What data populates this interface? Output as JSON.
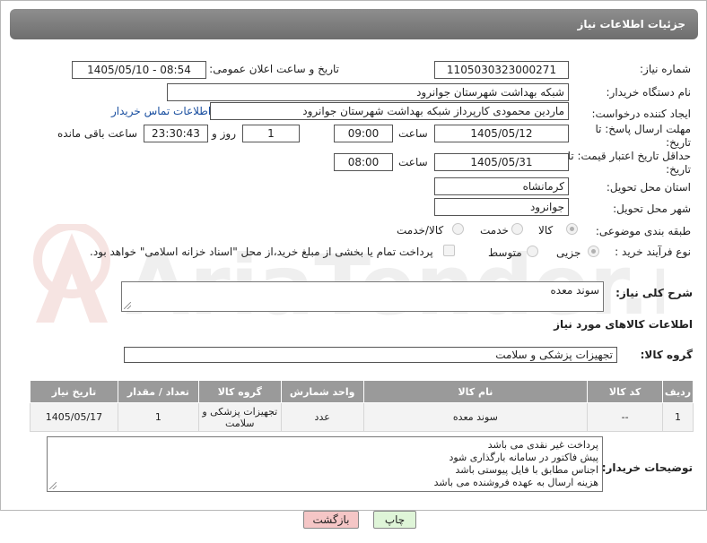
{
  "header": {
    "title": "جزئیات اطلاعات نیاز"
  },
  "fields": {
    "need_number_label": "شماره نیاز:",
    "need_number": "1105030323000271",
    "announce_label": "تاریخ و ساعت اعلان عمومی:",
    "announce_value": "1405/05/10 - 08:54",
    "buyer_org_label": "نام دستگاه خریدار:",
    "buyer_org": "شبکه بهداشت شهرستان جوانرود",
    "creator_label": "ایجاد کننده درخواست:",
    "creator": "ماردین محمودی کارپرداز شبکه بهداشت شهرستان جوانرود",
    "contact_link": "اطلاعات تماس خریدار",
    "deadline_label": "مهلت ارسال پاسخ: تا تاریخ:",
    "deadline_date": "1405/05/12",
    "time_label": "ساعت",
    "deadline_time": "09:00",
    "days": "1",
    "days_label": "روز و",
    "remaining_time": "23:30:43",
    "remaining_label": "ساعت باقی مانده",
    "price_validity_label": "حداقل تاریخ اعتبار قیمت: تا تاریخ:",
    "price_date": "1405/05/31",
    "price_time": "08:00",
    "province_label": "استان محل تحویل:",
    "province": "کرمانشاه",
    "city_label": "شهر محل تحویل:",
    "city": "جوانرود",
    "category_label": "طبقه بندی موضوعی:",
    "category_options": [
      "کالا",
      "خدمت",
      "کالا/خدمت"
    ],
    "process_label": "نوع فرآیند خرید :",
    "process_options": [
      "جزیی",
      "متوسط"
    ],
    "payment_note": "پرداخت تمام یا بخشی از مبلغ خرید،از محل \"اسناد خزانه اسلامی\" خواهد بود."
  },
  "description": {
    "label": "شرح کلی نیاز:",
    "value": "سوند معده"
  },
  "goods": {
    "section_title": "اطلاعات کالاهای مورد نیاز",
    "group_label": "گروه کالا:",
    "group_value": "تجهیزات پزشکی و سلامت",
    "columns": [
      "ردیف",
      "کد کالا",
      "نام کالا",
      "واحد شمارش",
      "گروه کالا",
      "تعداد / مقدار",
      "تاریخ نیاز"
    ],
    "rows": [
      [
        "1",
        "--",
        "سوند معده",
        "عدد",
        "تجهیزات پزشکی و سلامت",
        "1",
        "1405/05/17"
      ]
    ]
  },
  "buyer_notes": {
    "label": "توضیحات خریدار:",
    "lines": [
      "پرداخت غیر نقدی می باشد",
      "پیش فاکتور در سامانه بارگذاری شود",
      "اجناس مطابق با فایل پیوستی باشد",
      "هزینه ارسال به عهده فروشنده می باشد"
    ]
  },
  "buttons": {
    "print": "چاپ",
    "back": "بازگشت"
  },
  "watermark": "AriaTender.neT",
  "colors": {
    "header": "#7e7e7e",
    "link": "#1a4fa0",
    "back_button": "#f5c6c6",
    "print_button": "#dff5d8"
  }
}
